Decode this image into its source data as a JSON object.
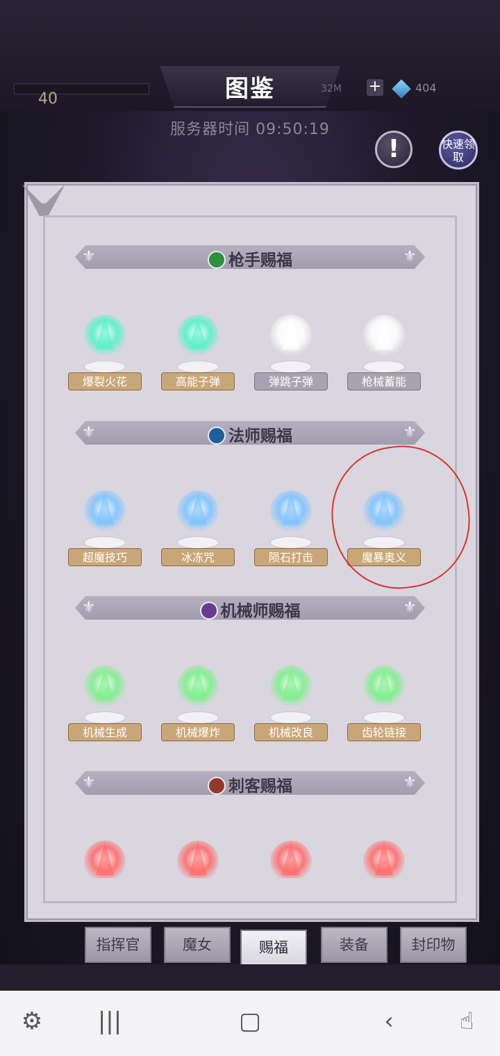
{
  "header": {
    "title": "图鉴",
    "energy_value": "40",
    "stamina_value": "32M",
    "gem_value": "404",
    "server_time": "服务器时间 09:50:19",
    "info_label": "!",
    "claim_label": "快速领取"
  },
  "sections": [
    {
      "title": "枪手赐福",
      "icon_color": "#2e8f3c",
      "icon": "gun-icon",
      "items": [
        {
          "label": "爆裂火花",
          "style": "gold",
          "glow": "#5af2c9",
          "icon": "bullet-icon"
        },
        {
          "label": "高能子弹",
          "style": "gold",
          "glow": "#5af2c9",
          "icon": "energy-bullet-icon"
        },
        {
          "label": "弹跳子弹",
          "style": "gray",
          "glow": "#ffffff",
          "icon": "ricochet-icon"
        },
        {
          "label": "枪械蓄能",
          "style": "gray",
          "glow": "#ffffff",
          "icon": "rifle-icon"
        }
      ]
    },
    {
      "title": "法师赐福",
      "icon_color": "#1c5f9c",
      "icon": "staff-icon",
      "items": [
        {
          "label": "超魔技巧",
          "style": "gold",
          "glow": "#7fc3ff",
          "icon": "arcane-orb-icon"
        },
        {
          "label": "冰冻咒",
          "style": "gold",
          "glow": "#7fc3ff",
          "icon": "snowflake-icon"
        },
        {
          "label": "陨石打击",
          "style": "gold",
          "glow": "#7fc3ff",
          "icon": "meteor-icon"
        },
        {
          "label": "魔暴奥义",
          "style": "gold",
          "glow": "#7fc3ff",
          "icon": "mana-storm-icon"
        }
      ]
    },
    {
      "title": "机械师赐福",
      "icon_color": "#6a3a8f",
      "icon": "gear-icon",
      "items": [
        {
          "label": "机械生成",
          "style": "gold",
          "glow": "#7ff08c",
          "icon": "mech-spider-icon"
        },
        {
          "label": "机械爆炸",
          "style": "gold",
          "glow": "#7ff08c",
          "icon": "chip-icon"
        },
        {
          "label": "机械改良",
          "style": "gold",
          "glow": "#7ff08c",
          "icon": "wrench-icon"
        },
        {
          "label": "齿轮链接",
          "style": "gold",
          "glow": "#7ff08c",
          "icon": "gear-link-icon"
        }
      ]
    },
    {
      "title": "刺客赐福",
      "icon_color": "#8f3a2a",
      "icon": "dagger-icon",
      "items": [
        {
          "label": "",
          "style": "gold",
          "glow": "#ff6b6b",
          "icon": "target-icon"
        },
        {
          "label": "",
          "style": "gold",
          "glow": "#ff6b6b",
          "icon": "blade-icon"
        },
        {
          "label": "",
          "style": "gold",
          "glow": "#ff6b6b",
          "icon": "shuriken-icon"
        },
        {
          "label": "",
          "style": "gold",
          "glow": "#ff6b6b",
          "icon": "kunai-icon"
        }
      ]
    }
  ],
  "tabs": [
    "指挥官",
    "魔女",
    "赐福",
    "装备",
    "封印物"
  ],
  "active_tab": "赐福",
  "annotation_color": "#d3352c"
}
